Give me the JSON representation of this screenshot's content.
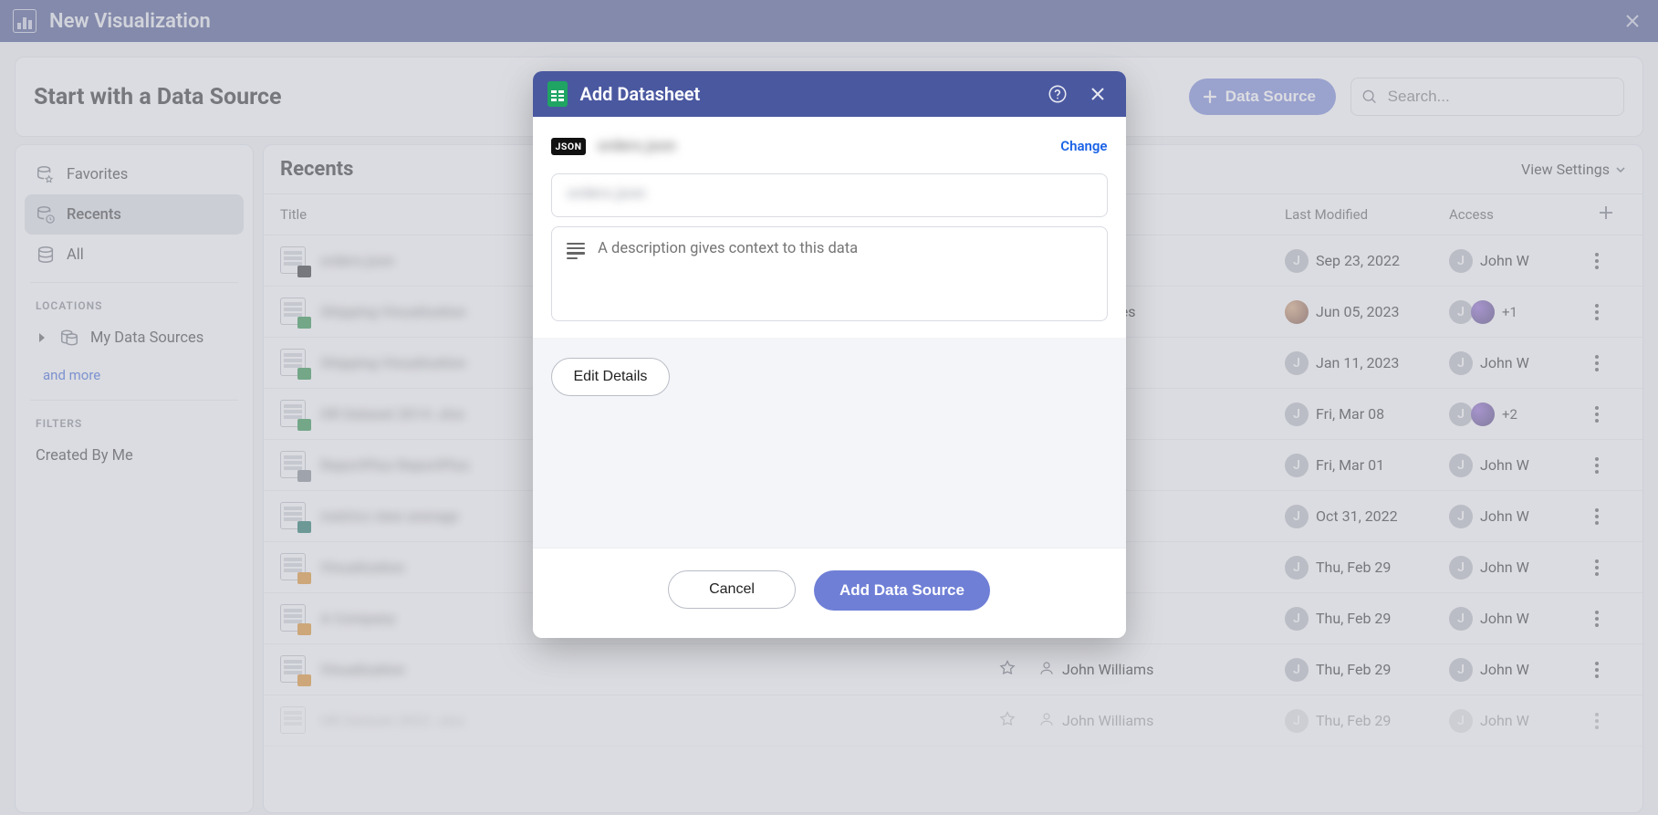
{
  "titlebar": {
    "title": "New Visualization"
  },
  "header": {
    "heading": "Start with a Data Source",
    "data_source_btn": "Data Source",
    "search_placeholder": "Search..."
  },
  "sidebar": {
    "items": [
      {
        "label": "Favorites"
      },
      {
        "label": "Recents"
      },
      {
        "label": "All"
      }
    ],
    "locations_label": "LOCATIONS",
    "my_data_sources": "My Data Sources",
    "and_more": "and more",
    "filters_label": "FILTERS",
    "created_by_me": "Created By Me"
  },
  "content": {
    "heading": "Recents",
    "view_settings": "View Settings",
    "columns": {
      "title": "Title",
      "last_modified": "Last Modified",
      "access": "Access"
    }
  },
  "rows": [
    {
      "title_blur": "orders.json",
      "badge": "json",
      "owner_type": "none",
      "modified": "Sep 23, 2022",
      "access_name": "John W",
      "extra": ""
    },
    {
      "title_blur": "Shipping Visualization",
      "badge": "xls",
      "owner_type": "text",
      "owner_text": "y Data Sources",
      "modified": "Jun 05, 2023",
      "access_name": "",
      "extra": "+1",
      "avatar": "photo1",
      "avatar2": "photo2"
    },
    {
      "title_blur": "Shipping Visualization",
      "badge": "xls",
      "owner_type": "none",
      "modified": "Jan 11, 2023",
      "access_name": "John W",
      "extra": ""
    },
    {
      "title_blur": "HR Dataset 2014 .xlsx",
      "badge": "xls",
      "owner_type": "none",
      "modified": "Fri, Mar 08",
      "access_name": "",
      "extra": "+2",
      "avatar2": "photo2"
    },
    {
      "title_blur": "ReportPlus ReportPlus",
      "badge": "sf",
      "owner_type": "none",
      "modified": "Fri, Mar 01",
      "access_name": "John W",
      "extra": ""
    },
    {
      "title_blur": "metrics view average",
      "badge": "csv",
      "owner_type": "none",
      "modified": "Oct 31, 2022",
      "access_name": "John W",
      "extra": ""
    },
    {
      "title_blur": "Visualization",
      "badge": "viz",
      "owner_type": "none",
      "modified": "Thu, Feb 29",
      "access_name": "John W",
      "extra": ""
    },
    {
      "title_blur": "A Company",
      "badge": "viz",
      "owner_type": "none",
      "modified": "Thu, Feb 29",
      "access_name": "John W",
      "extra": ""
    },
    {
      "title_blur": "Visualization",
      "badge": "viz",
      "owner_type": "person",
      "owner_text": "John Williams",
      "modified": "Thu, Feb 29",
      "access_name": "John W",
      "extra": ""
    },
    {
      "title_blur": "HR Dataset 2022 .xlsx",
      "badge": "none",
      "owner_type": "person",
      "owner_text": "John Williams",
      "modified": "Thu, Feb 29",
      "access_name": "John W",
      "extra": "",
      "faded": true
    }
  ],
  "modal": {
    "title": "Add Datasheet",
    "json_badge": "JSON",
    "filename_blur": "orders.json",
    "change": "Change",
    "name_blur_placeholder": "orders.json",
    "desc_placeholder": "A description gives context to this data",
    "edit_details": "Edit Details",
    "cancel": "Cancel",
    "add": "Add Data Source"
  }
}
